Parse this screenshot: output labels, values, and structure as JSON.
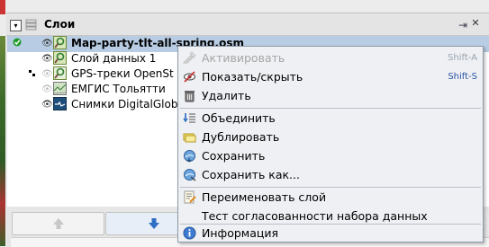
{
  "panel": {
    "title": "Слои",
    "expand_glyph": "▾",
    "pin_glyph": "⇥",
    "close_glyph": "✕"
  },
  "layers": [
    {
      "name": "Map-party-tlt-all-spring.osm",
      "icon": "osm-data-icon",
      "visible": true,
      "active": true
    },
    {
      "name": "Слой данных 1",
      "icon": "osm-data-icon",
      "visible": true,
      "active": false
    },
    {
      "name": "GPS-треки OpenSt",
      "icon": "gps-traces-icon",
      "visible": false,
      "active": false
    },
    {
      "name": "ЕМГИС Тольятти",
      "icon": "map-imagery-icon",
      "visible": false,
      "active": false
    },
    {
      "name": "Снимки DigitalGlob",
      "icon": "satellite-imagery-icon",
      "visible": true,
      "active": false
    }
  ],
  "eye_glyph": "👁",
  "context_menu": {
    "items": [
      {
        "label": "Активировать",
        "shortcut": "Shift-A",
        "disabled": true,
        "icon": "activate-icon"
      },
      {
        "label": "Показать/скрыть",
        "shortcut": "Shift-S",
        "disabled": false,
        "icon": "show-hide-icon"
      },
      {
        "label": "Удалить",
        "shortcut": "",
        "disabled": false,
        "icon": "delete-icon"
      },
      {
        "label": "Объединить",
        "shortcut": "",
        "disabled": false,
        "icon": "merge-icon"
      },
      {
        "label": "Дублировать",
        "shortcut": "",
        "disabled": false,
        "icon": "duplicate-icon"
      },
      {
        "label": "Сохранить",
        "shortcut": "",
        "disabled": false,
        "icon": "save-icon"
      },
      {
        "label": "Сохранить как...",
        "shortcut": "",
        "disabled": false,
        "icon": "save-as-icon"
      },
      {
        "label": "Переименовать слой",
        "shortcut": "",
        "disabled": false,
        "icon": "rename-icon"
      },
      {
        "label": "Тест согласованности набора данных",
        "shortcut": "",
        "disabled": false,
        "icon": ""
      },
      {
        "label": "Информация",
        "shortcut": "",
        "disabled": false,
        "icon": "info-icon"
      }
    ]
  },
  "colors": {
    "selection": "#b8cde3",
    "accent_blue": "#2d6fc4",
    "active_green": "#1e9b2c"
  }
}
